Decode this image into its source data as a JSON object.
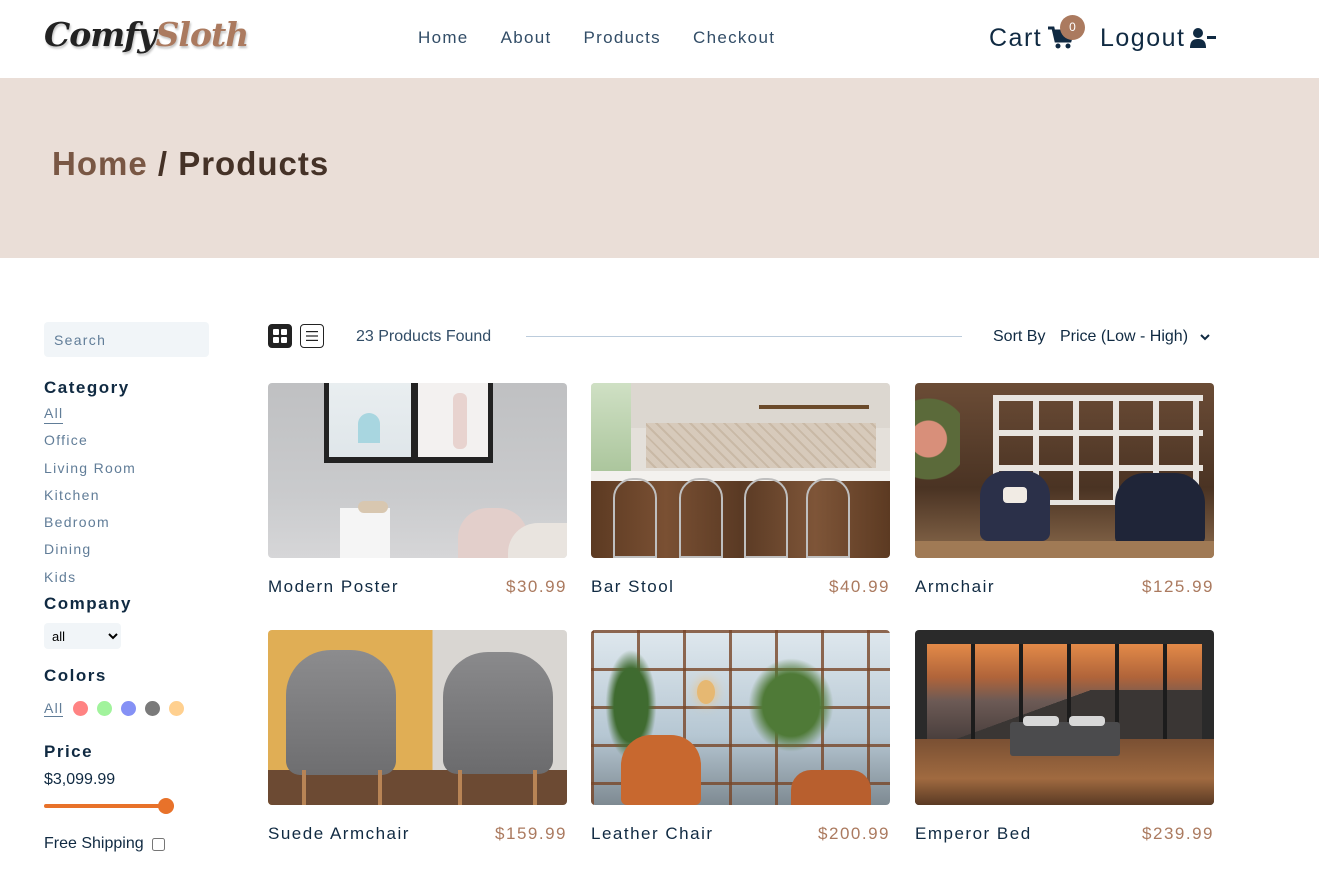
{
  "brand": {
    "part1": "Comfy",
    "part2": "Sloth"
  },
  "nav": {
    "links": [
      "Home",
      "About",
      "Products",
      "Checkout"
    ]
  },
  "cart": {
    "label": "Cart",
    "count": "0"
  },
  "logout": {
    "label": "Logout"
  },
  "hero": {
    "home": "Home",
    "separator": " / ",
    "current": "Products"
  },
  "filters": {
    "search_placeholder": "Search",
    "category_title": "Category",
    "categories": [
      "All",
      "Office",
      "Living Room",
      "Kitchen",
      "Bedroom",
      "Dining",
      "Kids"
    ],
    "company_title": "Company",
    "company_selected": "all",
    "colors_title": "Colors",
    "colors_all": "All",
    "colors": [
      "#ff8383",
      "#a1f39c",
      "#8591f5",
      "#7a7a7a",
      "#ffd08f"
    ],
    "price_title": "Price",
    "price_value": "$3,099.99",
    "price_slider_fraction": 1.0,
    "shipping_label": "Free Shipping"
  },
  "toolbar": {
    "count_text": "23 Products Found",
    "sort_label": "Sort By",
    "sort_selected": "Price (Low - High)"
  },
  "products": [
    {
      "name": "Modern Poster",
      "price": "$30.99"
    },
    {
      "name": "Bar Stool",
      "price": "$40.99"
    },
    {
      "name": "Armchair",
      "price": "$125.99"
    },
    {
      "name": "Suede Armchair",
      "price": "$159.99"
    },
    {
      "name": "Leather Chair",
      "price": "$200.99"
    },
    {
      "name": "Emperor Bed",
      "price": "$239.99"
    }
  ],
  "colors": {
    "accent": "#ab7a5f",
    "hero_bg": "#eaded7",
    "slider": "#e8722a"
  }
}
